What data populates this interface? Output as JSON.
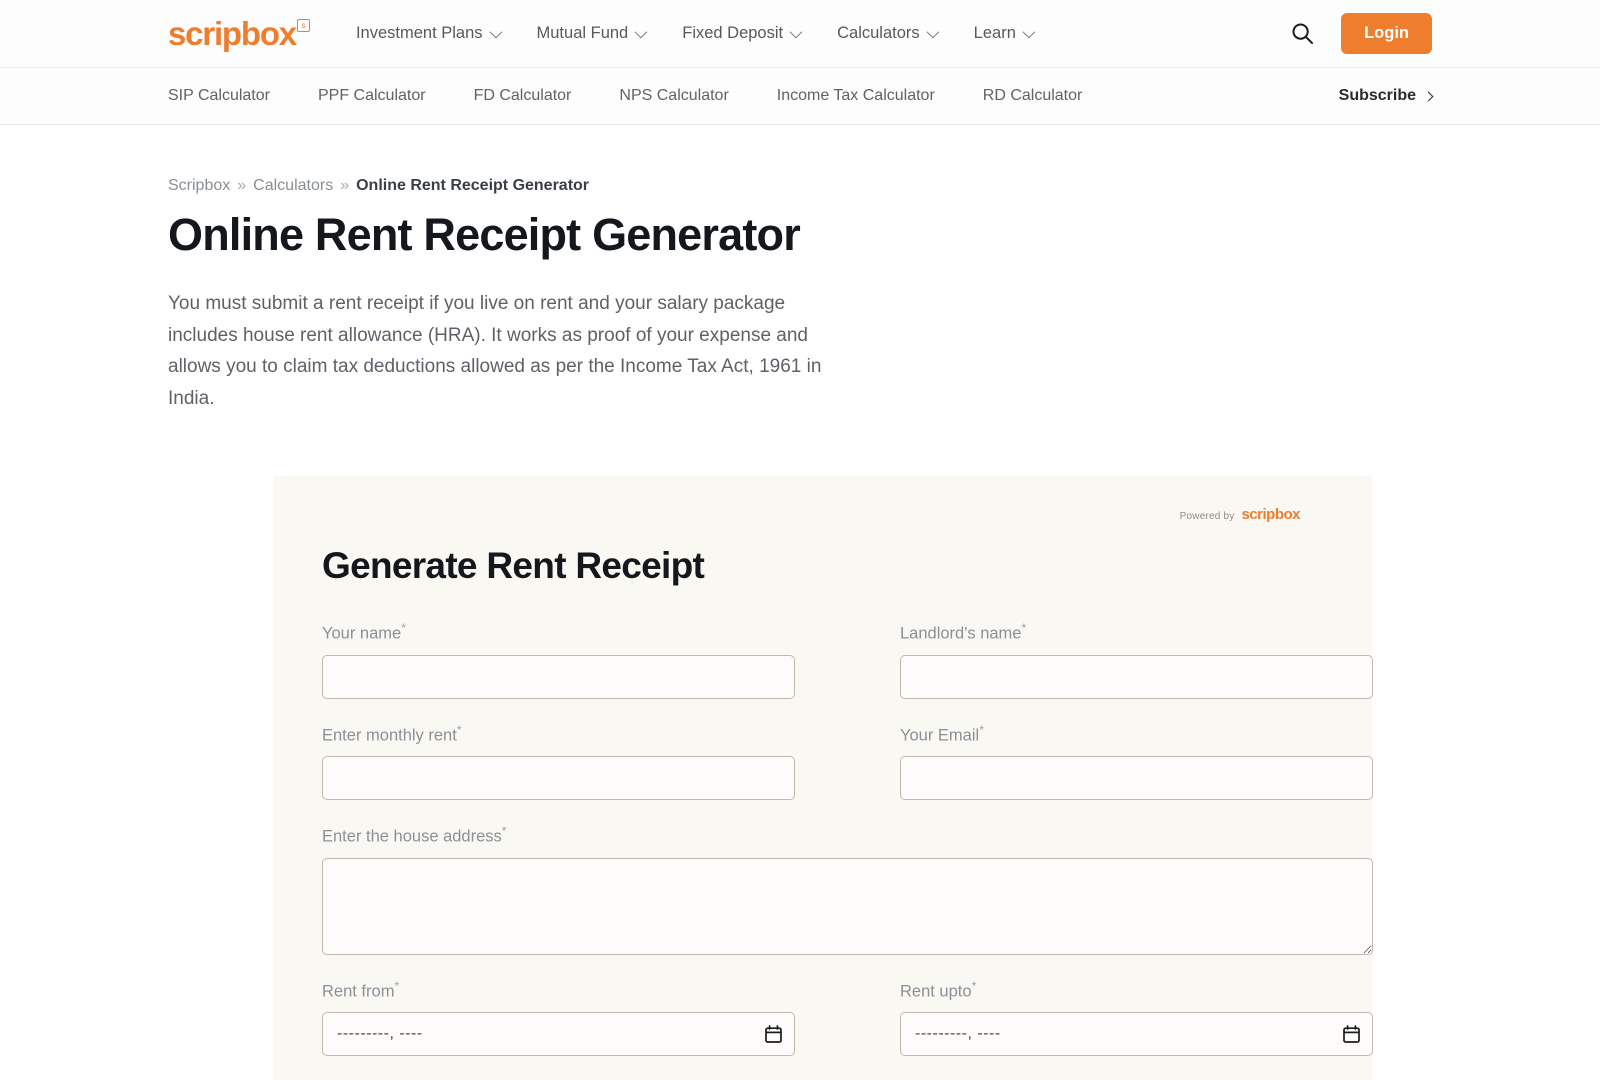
{
  "header": {
    "logo_text": "scripbox",
    "logo_badge": "s",
    "nav_items": [
      {
        "label": "Investment Plans",
        "has_caret": true
      },
      {
        "label": "Mutual Fund",
        "has_caret": true
      },
      {
        "label": "Fixed Deposit",
        "has_caret": true
      },
      {
        "label": "Calculators",
        "has_caret": true
      },
      {
        "label": "Learn",
        "has_caret": true
      }
    ],
    "search_icon": "search-icon",
    "login_label": "Login",
    "accent_color": "#ef7d2e"
  },
  "subnav": {
    "items": [
      {
        "label": "SIP Calculator"
      },
      {
        "label": "PPF Calculator"
      },
      {
        "label": "FD Calculator"
      },
      {
        "label": "NPS Calculator"
      },
      {
        "label": "Income Tax Calculator"
      },
      {
        "label": "RD Calculator"
      }
    ],
    "subscribe_label": "Subscribe"
  },
  "breadcrumb": {
    "items": [
      {
        "label": "Scripbox"
      },
      {
        "label": "Calculators"
      },
      {
        "label": "Online Rent Receipt Generator"
      }
    ],
    "separator": "»"
  },
  "main": {
    "title": "Online Rent Receipt Generator",
    "description": "You must submit a rent receipt if you live on rent and your salary package includes house rent allowance (HRA). It works as proof of your expense and allows you to claim tax deductions allowed as per the Income Tax Act, 1961 in India."
  },
  "form": {
    "powered_by_label": "Powered by",
    "powered_by_brand": "scripbox",
    "card_title": "Generate Rent Receipt",
    "required_marker": "*",
    "fields": {
      "your_name": {
        "label": "Your name",
        "value": "",
        "placeholder": ""
      },
      "landlord_name": {
        "label": "Landlord's name",
        "value": "",
        "placeholder": ""
      },
      "monthly_rent": {
        "label": "Enter monthly rent",
        "value": "",
        "placeholder": ""
      },
      "your_email": {
        "label": "Your Email",
        "value": "",
        "placeholder": ""
      },
      "house_address": {
        "label": "Enter the house address",
        "value": "",
        "placeholder": ""
      },
      "rent_from": {
        "label": "Rent from",
        "value": "---------, ----",
        "icon": "calendar-icon"
      },
      "rent_upto": {
        "label": "Rent upto",
        "value": "---------, ----",
        "icon": "calendar-icon"
      }
    }
  }
}
